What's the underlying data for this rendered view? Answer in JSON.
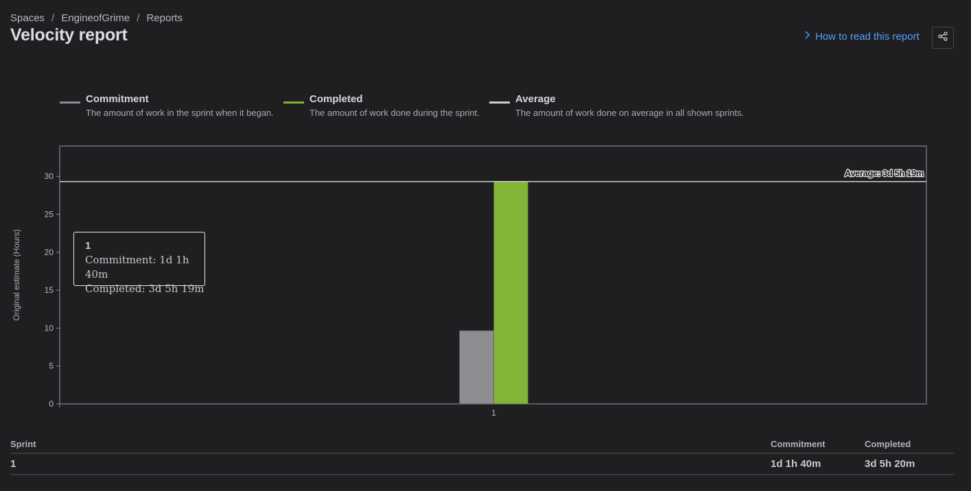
{
  "breadcrumb": {
    "spaces": "Spaces",
    "space": "EngineofGrime",
    "reports": "Reports",
    "separator": "/"
  },
  "page": {
    "title": "Velocity report"
  },
  "help": {
    "label": "How to read this report"
  },
  "legend": [
    {
      "name": "Commitment",
      "desc": "The amount of work in the sprint when it began.",
      "color": "#8c8d90"
    },
    {
      "name": "Completed",
      "desc": "The amount of work done during the sprint.",
      "color": "#82b536"
    },
    {
      "name": "Average",
      "desc": "The amount of work done on average in all shown sprints.",
      "color": "#cfd0d2"
    }
  ],
  "chart_data": {
    "type": "bar",
    "categories": [
      "1"
    ],
    "series": [
      {
        "name": "Commitment",
        "values": [
          9.67
        ],
        "color": "#8c8d90"
      },
      {
        "name": "Completed",
        "values": [
          29.32
        ],
        "color": "#82b536"
      }
    ],
    "average": {
      "value": 29.32,
      "label": "Average: 3d 5h 19m"
    },
    "ylabel": "Original estimate (Hours)",
    "xlabel": "",
    "ylim": [
      0,
      34
    ],
    "yticks": [
      0,
      5,
      10,
      15,
      20,
      25,
      30
    ]
  },
  "tooltip": {
    "title": "1",
    "commitment": "Commitment: 1d 1h 40m",
    "completed": "Completed: 3d 5h 19m"
  },
  "table": {
    "headers": [
      "Sprint",
      "Commitment",
      "Completed"
    ],
    "rows": [
      [
        "1",
        "1d 1h 40m",
        "3d 5h 20m"
      ]
    ]
  }
}
